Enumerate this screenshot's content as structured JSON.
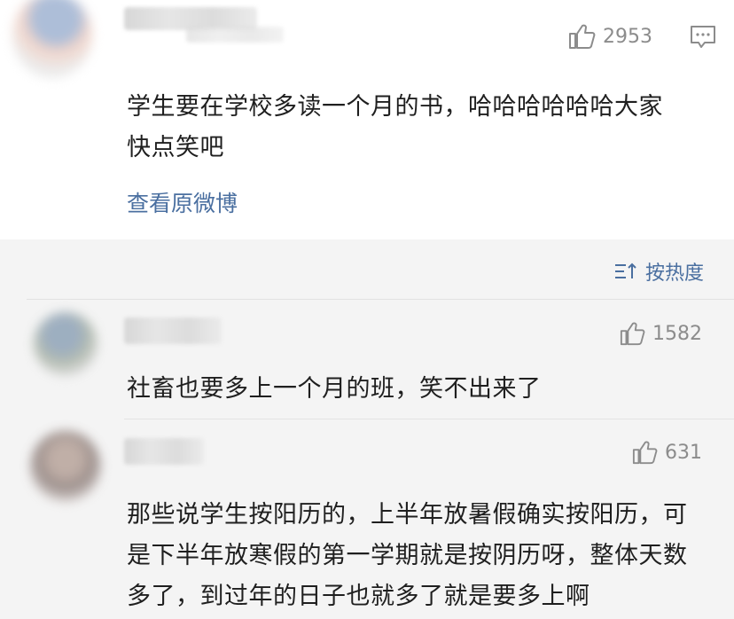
{
  "post": {
    "likes": "2953",
    "text_line1": "学生要在学校多读一个月的书，哈哈哈哈哈哈大家",
    "text_line2": "快点笑吧",
    "view_original": "查看原微博"
  },
  "sort": {
    "label": "按热度"
  },
  "comments": [
    {
      "likes": "1582",
      "lines": [
        "社畜也要多上一个月的班，笑不出来了"
      ]
    },
    {
      "likes": "631",
      "lines": [
        "那些说学生按阳历的，上半年放暑假确实按阳历，可",
        "是下半年放寒假的第一学期就是按阴历呀，整体天数",
        "多了，到过年的日子也就多了就是要多上啊"
      ]
    }
  ],
  "colors": {
    "link": "#4a6fa0",
    "meta": "#8c8c8c",
    "background": "#f4f4f4"
  }
}
